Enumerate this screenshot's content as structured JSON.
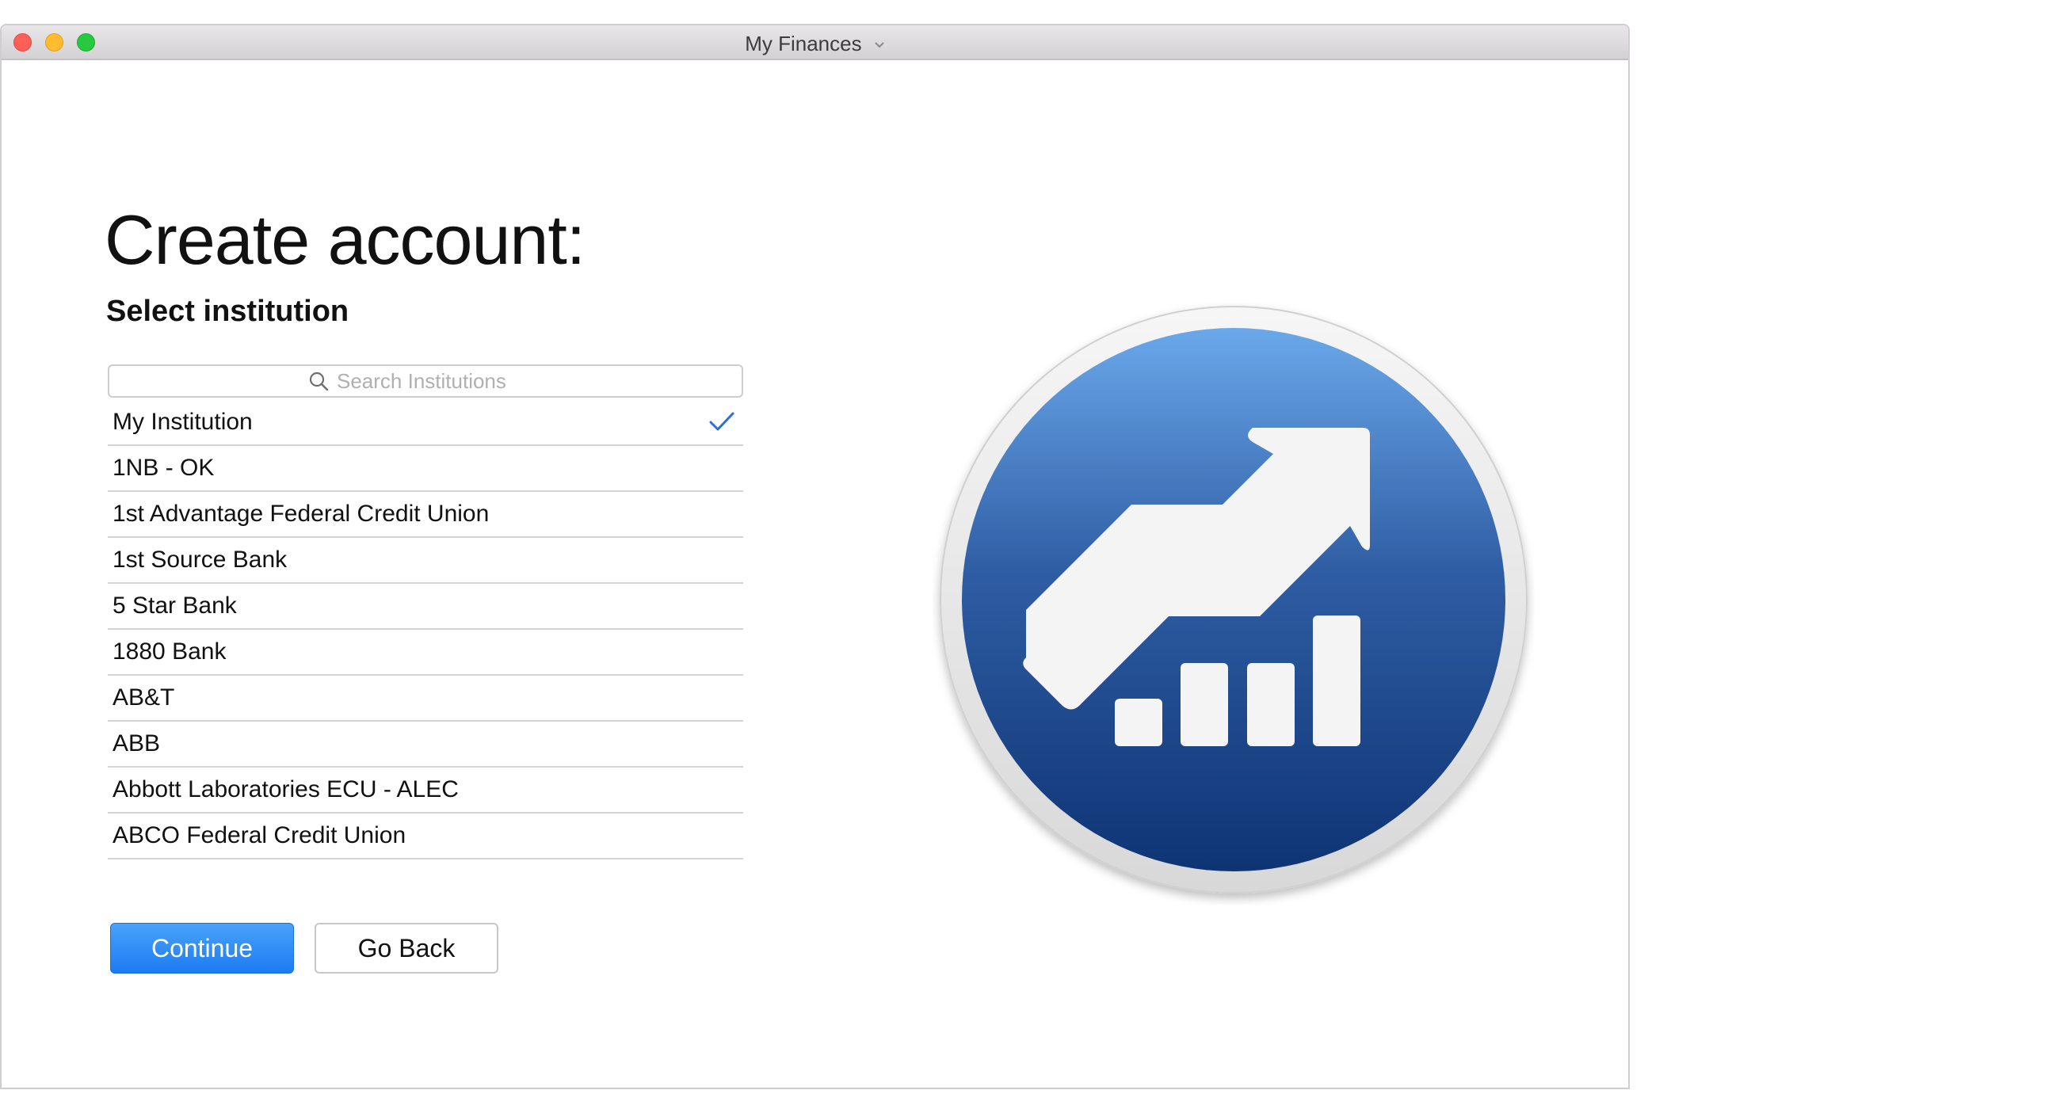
{
  "window": {
    "title": "My Finances"
  },
  "main": {
    "heading": "Create account:",
    "subheading": "Select institution",
    "search": {
      "placeholder": "Search Institutions",
      "value": ""
    },
    "institutions": [
      {
        "label": "My Institution",
        "selected": true
      },
      {
        "label": "1NB - OK",
        "selected": false
      },
      {
        "label": "1st Advantage Federal Credit Union",
        "selected": false
      },
      {
        "label": "1st Source Bank",
        "selected": false
      },
      {
        "label": "5 Star Bank",
        "selected": false
      },
      {
        "label": "1880 Bank",
        "selected": false
      },
      {
        "label": "AB&T",
        "selected": false
      },
      {
        "label": "ABB",
        "selected": false
      },
      {
        "label": "Abbott Laboratories ECU - ALEC",
        "selected": false
      },
      {
        "label": "ABCO Federal Credit Union",
        "selected": false
      }
    ],
    "continue_label": "Continue",
    "goback_label": "Go Back"
  },
  "icons": {
    "search": "search-icon",
    "checkmark": "checkmark-icon",
    "app_logo": "finance-growth-logo-icon"
  },
  "colors": {
    "accent": "#1c7bf1",
    "check": "#2a6fd6",
    "logo_top": "#6aa8ea",
    "logo_bottom": "#0e3474"
  }
}
